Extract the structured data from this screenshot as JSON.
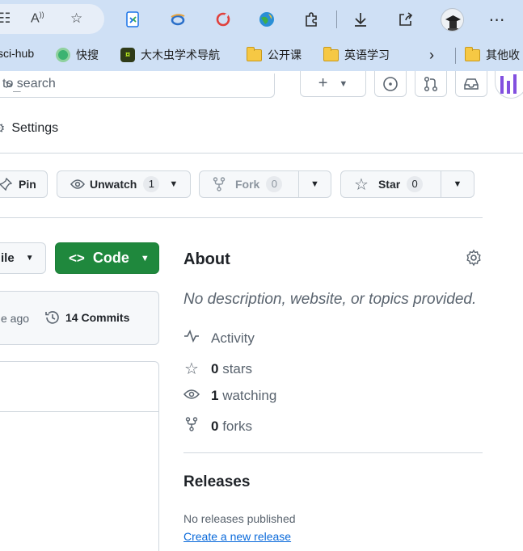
{
  "bookmarks": [
    {
      "label": "sci-hub",
      "icon": "scihub-icon"
    },
    {
      "label": "快搜",
      "icon": "kuaisou-icon"
    },
    {
      "label": "大木虫学术导航",
      "icon": "damuchong-icon"
    },
    {
      "label": "公开课",
      "icon": "folder-icon"
    },
    {
      "label": "英语学习",
      "icon": "folder-icon"
    },
    {
      "label": "其他收",
      "icon": "folder-icon"
    }
  ],
  "header": {
    "search_placeholder": "to search",
    "settings_label": "Settings"
  },
  "repo_actions": {
    "pin_label": "Pin",
    "unwatch_label": "Unwatch",
    "watch_count": "1",
    "fork_label": "Fork",
    "fork_count": "0",
    "star_label": "Star",
    "star_count": "0"
  },
  "file_nav": {
    "file_label": "ile",
    "code_label": "Code",
    "commit_time": "e ago",
    "commits_label": "14 Commits"
  },
  "about": {
    "title": "About",
    "description": "No description, website, or topics provided.",
    "activity_label": "Activity",
    "stars_count": "0",
    "stars_label": "stars",
    "watching_count": "1",
    "watching_label": "watching",
    "forks_count": "0",
    "forks_label": "forks"
  },
  "releases": {
    "title": "Releases",
    "none_text": "No releases published",
    "create_link": "Create a new release"
  },
  "colors": {
    "code_button": "#1f883d",
    "link": "#0969da",
    "browser_chrome": "#cfe0f5"
  }
}
